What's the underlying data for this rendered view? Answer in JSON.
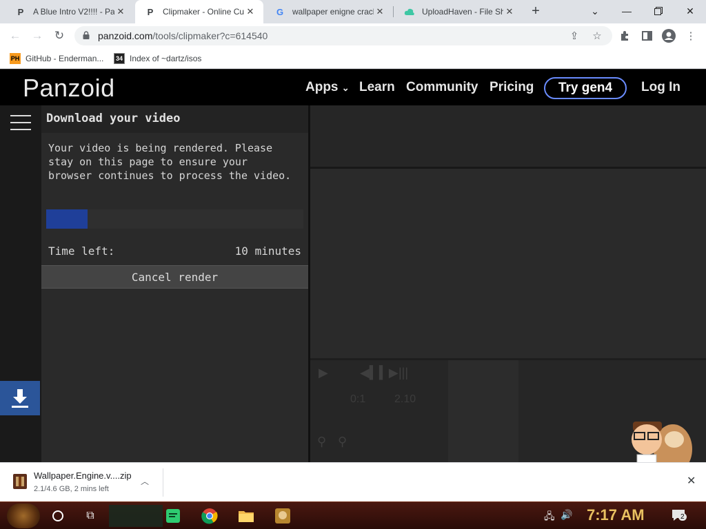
{
  "browser": {
    "tabs": [
      {
        "title": "A Blue Intro V2!!!! - Par",
        "favicon": "P",
        "active": false
      },
      {
        "title": "Clipmaker - Online Cus",
        "favicon": "P",
        "active": true
      },
      {
        "title": "wallpaper enigne crack",
        "favicon": "G",
        "active": false
      },
      {
        "title": "UploadHaven - File Sha",
        "favicon": "cloud",
        "active": false
      }
    ],
    "url_host": "panzoid.com",
    "url_path": "/tools/clipmaker?c=614540",
    "bookmarks": [
      {
        "label": "GitHub - Enderman...",
        "icon": "PH"
      },
      {
        "label": "Index of ~dartz/isos",
        "icon": "34"
      }
    ]
  },
  "site": {
    "logo": "Panzoid",
    "nav": {
      "apps": "Apps",
      "learn": "Learn",
      "community": "Community",
      "pricing": "Pricing",
      "try_gen4": "Try gen4",
      "login": "Log In"
    }
  },
  "dialog": {
    "title": "Download your video",
    "message": "Your video is being rendered. Please stay on this page to ensure your browser continues to process the video.",
    "progress": 0.16,
    "time_left_label": "Time left:",
    "time_left_value": "10 minutes",
    "cancel_label": "Cancel render"
  },
  "timeline": {
    "current_time": "0:1",
    "total_time": "2.10"
  },
  "download_shelf": {
    "file_name": "Wallpaper.Engine.v....zip",
    "status": "2.1/4.6 GB, 2 mins left"
  },
  "taskbar": {
    "clock": "7:17 AM",
    "notification_count": "2"
  },
  "colors": {
    "panzoid_header": "#000000",
    "progress_fill": "#1f3f99",
    "download_button": "#2b5599",
    "gen4_border": "#6a8cff",
    "clock": "#e8c060"
  }
}
